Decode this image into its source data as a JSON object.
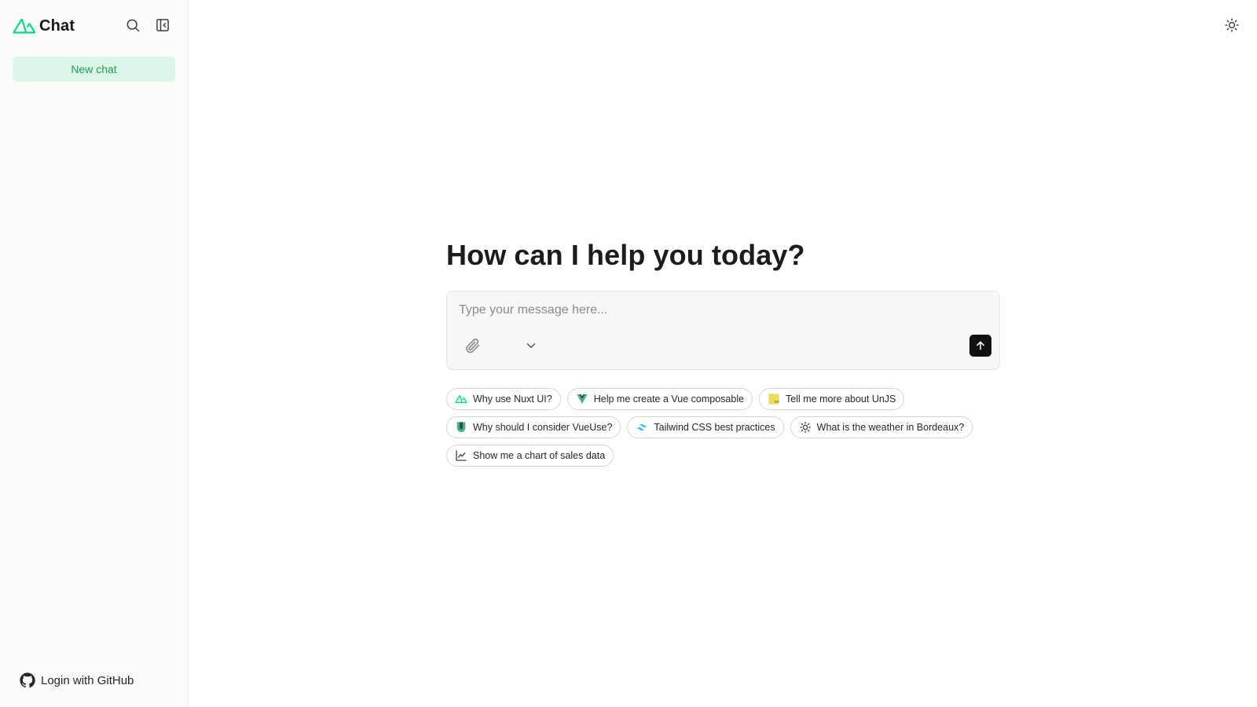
{
  "sidebar": {
    "brand": "Chat",
    "new_chat_label": "New chat",
    "login_label": "Login with GitHub"
  },
  "main": {
    "title": "How can I help you today?",
    "composer": {
      "placeholder": "Type your message here...",
      "value": ""
    },
    "suggestions": [
      {
        "label": "Why use Nuxt UI?",
        "icon": "nuxt-icon"
      },
      {
        "label": "Help me create a Vue composable",
        "icon": "vue-icon"
      },
      {
        "label": "Tell me more about UnJS",
        "icon": "unjs-icon"
      },
      {
        "label": "Why should I consider VueUse?",
        "icon": "vueuse-icon"
      },
      {
        "label": "Tailwind CSS best practices",
        "icon": "tailwind-icon"
      },
      {
        "label": "What is the weather in Bordeaux?",
        "icon": "sun-icon"
      },
      {
        "label": "Show me a chart of sales data",
        "icon": "chart-line-icon"
      }
    ]
  },
  "colors": {
    "accent": "#16a34a",
    "accent_bg": "#dcf5e8",
    "nuxt_green": "#00dc82"
  }
}
